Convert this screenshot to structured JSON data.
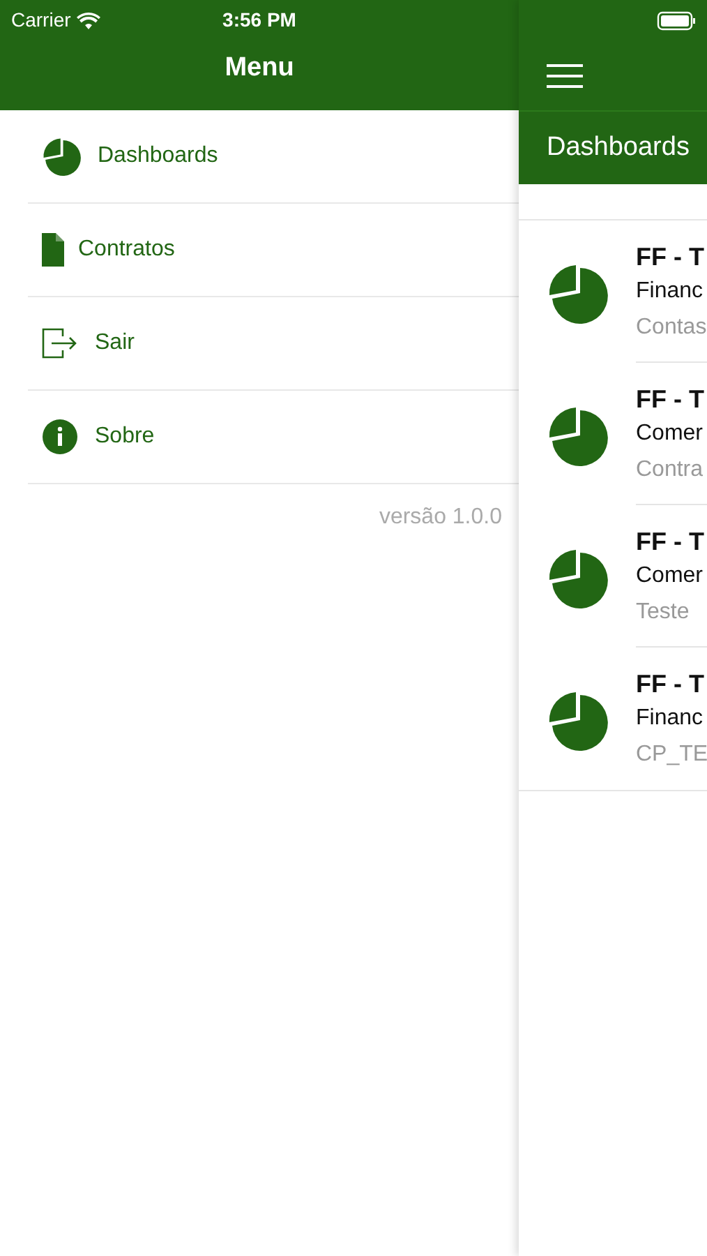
{
  "status_bar": {
    "carrier": "Carrier",
    "time": "3:56 PM"
  },
  "menu": {
    "title": "Menu",
    "items": [
      {
        "kind": "pie",
        "label": "Dashboards"
      },
      {
        "kind": "document",
        "label": "Contratos"
      },
      {
        "kind": "exit",
        "label": "Sair"
      },
      {
        "kind": "info",
        "label": "Sobre"
      }
    ],
    "version": "versão 1.0.0"
  },
  "main": {
    "title": "Dashboards",
    "items": [
      {
        "title": "FF - T",
        "subtitle": "Financ",
        "detail": "Contas"
      },
      {
        "title": "FF - T",
        "subtitle": "Comer",
        "detail": "Contra"
      },
      {
        "title": "FF - T",
        "subtitle": "Comer",
        "detail": "Teste"
      },
      {
        "title": "FF - T",
        "subtitle": "Financ",
        "detail": "CP_TE"
      }
    ]
  }
}
